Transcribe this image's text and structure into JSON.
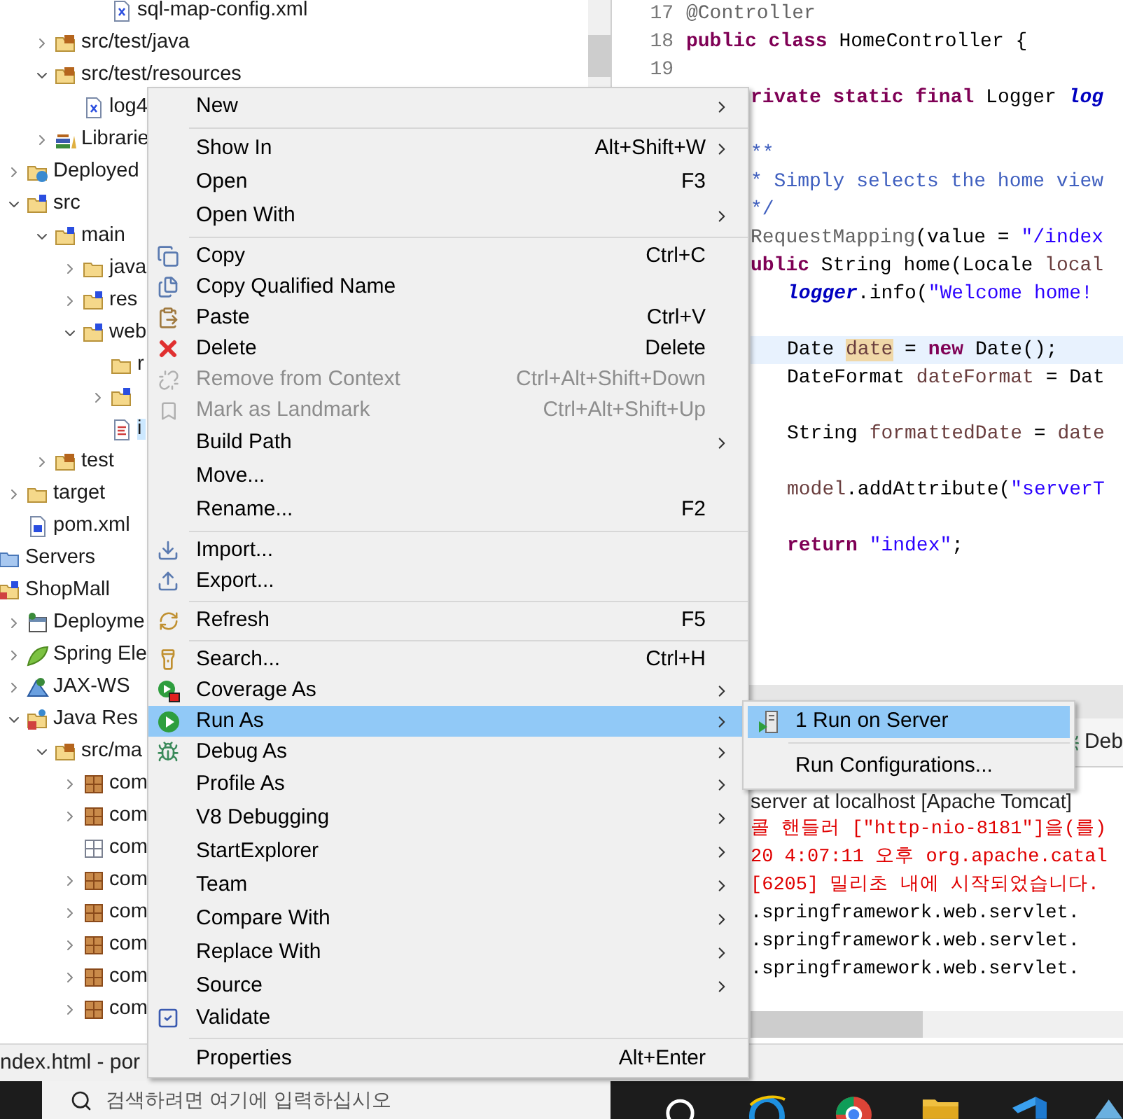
{
  "tree": [
    {
      "children": [
        {
          "children": [
            {
              "children": [
                {
                  "children": [
                    {
                      "label": "sql-map-config.xml",
                      "kind": "xml",
                      "selected": false
                    }
                  ]
                }
              ]
            },
            {
              "label": "src/test/java",
              "kind": "source-folder",
              "expanded": false,
              "selected": false
            },
            {
              "label": "src/test/resources",
              "kind": "source-folder",
              "expanded": true,
              "selected": false,
              "children": [
                {
                  "label": "log4",
                  "kind": "xml",
                  "selected": false
                }
              ]
            },
            {
              "label": "Librarie",
              "kind": "library",
              "expanded": false,
              "selected": false
            }
          ]
        },
        {
          "label": "Deployed",
          "kind": "deployed",
          "expanded": false,
          "selected": false
        },
        {
          "label": "src",
          "kind": "spring-folder",
          "expanded": true,
          "selected": false,
          "children": [
            {
              "label": "main",
              "kind": "spring-folder",
              "expanded": true,
              "selected": false,
              "children": [
                {
                  "label": "java",
                  "kind": "folder",
                  "expanded": false,
                  "selected": false
                },
                {
                  "label": "res",
                  "kind": "spring-folder",
                  "expanded": false,
                  "selected": false
                },
                {
                  "label": "web",
                  "kind": "spring-folder",
                  "expanded": true,
                  "selected": false,
                  "children": [
                    {
                      "label": "r",
                      "kind": "folder",
                      "selected": false
                    },
                    {
                      "kind": "spring-folder",
                      "expanded": false,
                      "selected": false
                    },
                    {
                      "label": "i",
                      "kind": "html",
                      "selected": true
                    }
                  ]
                }
              ]
            },
            {
              "label": "test",
              "kind": "source-folder",
              "expanded": false,
              "selected": false
            }
          ]
        },
        {
          "label": "target",
          "kind": "folder",
          "expanded": false,
          "selected": false
        },
        {
          "label": "pom.xml",
          "kind": "maven",
          "selected": false
        }
      ]
    },
    {
      "label": "Servers",
      "kind": "servers",
      "selected": false
    },
    {
      "label": "ShopMall",
      "kind": "project",
      "selected": false,
      "children": [
        {
          "label": "Deployme",
          "kind": "deploy-descriptor",
          "expanded": false,
          "selected": false
        },
        {
          "label": "Spring Ele",
          "kind": "spring",
          "expanded": false,
          "selected": false
        },
        {
          "label": "JAX-WS",
          "kind": "webservice",
          "expanded": false,
          "selected": false
        },
        {
          "label": "Java Res",
          "kind": "java-resources",
          "expanded": true,
          "selected": false,
          "children": [
            {
              "label": "src/ma",
              "kind": "source-folder",
              "expanded": true,
              "selected": false,
              "children": [
                {
                  "label": "com",
                  "kind": "package",
                  "expanded": false,
                  "selected": false
                },
                {
                  "label": "com",
                  "kind": "package",
                  "expanded": false,
                  "selected": false
                },
                {
                  "label": "com",
                  "kind": "empty-package",
                  "selected": false
                },
                {
                  "label": "com",
                  "kind": "package",
                  "expanded": false,
                  "selected": false
                },
                {
                  "label": "com",
                  "kind": "package",
                  "expanded": false,
                  "selected": false
                },
                {
                  "label": "com",
                  "kind": "package",
                  "expanded": false,
                  "selected": false
                },
                {
                  "label": "com",
                  "kind": "package",
                  "expanded": false,
                  "selected": false
                },
                {
                  "label": "com",
                  "kind": "package",
                  "expanded": false,
                  "selected": false
                }
              ]
            }
          ]
        }
      ]
    }
  ],
  "editor": {
    "lines": [
      {
        "kind": "code",
        "number": "17",
        "tokens": [
          {
            "t": "@Controller",
            "kind": "annotation"
          }
        ]
      },
      {
        "kind": "code",
        "number": "18",
        "tokens": [
          {
            "t": "public class",
            "kind": "keyword"
          },
          {
            "t": " HomeController {",
            "kind": "plain"
          }
        ]
      },
      {
        "kind": "code",
        "number": "19"
      },
      {
        "kind": "code",
        "tokens": [
          {
            "t": "rivate static final",
            "kind": "keyword"
          },
          {
            "t": " Logger ",
            "kind": "plain"
          },
          {
            "t": "log",
            "kind": "field"
          }
        ]
      },
      {
        "kind": "blank"
      },
      {
        "kind": "code",
        "tokens": [
          {
            "t": "**",
            "kind": "comment"
          }
        ]
      },
      {
        "kind": "code",
        "tokens": [
          {
            "t": "* Simply selects the home view",
            "kind": "comment"
          }
        ]
      },
      {
        "kind": "code",
        "tokens": [
          {
            "t": "*/",
            "kind": "comment"
          }
        ]
      },
      {
        "kind": "code",
        "tokens": [
          {
            "t": "RequestMapping",
            "kind": "annotation"
          },
          {
            "t": "(value = ",
            "kind": "plain"
          },
          {
            "t": "\"/index",
            "kind": "string"
          }
        ]
      },
      {
        "kind": "code",
        "tokens": [
          {
            "t": "ublic",
            "kind": "keyword"
          },
          {
            "t": " String home(Locale ",
            "kind": "plain"
          },
          {
            "t": "local",
            "kind": "variable"
          }
        ]
      },
      {
        "kind": "code",
        "indent": true,
        "tokens": [
          {
            "t": "logger",
            "kind": "field"
          },
          {
            "t": ".info(",
            "kind": "plain"
          },
          {
            "t": "\"Welcome home!",
            "kind": "string"
          }
        ]
      },
      {
        "kind": "blank"
      },
      {
        "kind": "code",
        "indent": true,
        "current": true,
        "tokens": [
          {
            "t": "Date ",
            "kind": "plain"
          },
          {
            "t": "date",
            "kind": "occurrence"
          },
          {
            "t": " = ",
            "kind": "plain"
          },
          {
            "t": "new",
            "kind": "keyword"
          },
          {
            "t": " Date();",
            "kind": "plain"
          }
        ]
      },
      {
        "kind": "code",
        "indent": true,
        "tokens": [
          {
            "t": "DateFormat ",
            "kind": "plain"
          },
          {
            "t": "dateFormat",
            "kind": "variable"
          },
          {
            "t": " = Dat",
            "kind": "plain"
          }
        ]
      },
      {
        "kind": "blank"
      },
      {
        "kind": "code",
        "indent": true,
        "tokens": [
          {
            "t": "String ",
            "kind": "plain"
          },
          {
            "t": "formattedDate",
            "kind": "variable"
          },
          {
            "t": " = ",
            "kind": "plain"
          },
          {
            "t": "date",
            "kind": "variable"
          }
        ]
      },
      {
        "kind": "blank"
      },
      {
        "kind": "code",
        "indent": true,
        "tokens": [
          {
            "t": "model",
            "kind": "variable"
          },
          {
            "t": ".addAttribute(",
            "kind": "plain"
          },
          {
            "t": "\"serverT",
            "kind": "string"
          }
        ]
      },
      {
        "kind": "blank"
      },
      {
        "kind": "code",
        "indent": true,
        "tokens": [
          {
            "t": "return",
            "kind": "keyword"
          },
          {
            "t": " \"index\"",
            "kind": "string"
          },
          {
            "t": ";",
            "kind": "plain"
          }
        ]
      }
    ]
  },
  "bottom_panel": {
    "tab": "Deb",
    "console_title": "server at localhost [Apache Tomcat]",
    "lines": [
      {
        "text": "콜 핸들러 [\"http-nio-8181\"]을(를)",
        "kind": "error"
      },
      {
        "text": "20 4:07:11 오후 org.apache.catal",
        "kind": "error"
      },
      {
        "text": "[6205] 밀리초 내에 시작되었습니다.",
        "kind": "error"
      },
      {
        "text": ".springframework.web.servlet.",
        "kind": "plain"
      },
      {
        "text": ".springframework.web.servlet.",
        "kind": "plain"
      },
      {
        "text": ".springframework.web.servlet.",
        "kind": "plain"
      }
    ]
  },
  "status_bar": {
    "text": "ndex.html - por"
  },
  "taskbar": {
    "search_placeholder": "검색하려면 여기에 입력하십시오"
  },
  "menu": {
    "items": [
      {
        "kind": "item",
        "label": "New",
        "submenu": true,
        "disabled": false,
        "selected": false
      },
      {
        "kind": "separator"
      },
      {
        "kind": "item",
        "label": "Show In",
        "shortcut": "Alt+Shift+W",
        "submenu": true,
        "disabled": false,
        "selected": false
      },
      {
        "kind": "item",
        "label": "Open",
        "shortcut": "F3",
        "submenu": false,
        "disabled": false,
        "selected": false
      },
      {
        "kind": "item",
        "label": "Open With",
        "submenu": true,
        "disabled": false,
        "selected": false
      },
      {
        "kind": "separator"
      },
      {
        "kind": "item",
        "label": "Copy",
        "shortcut": "Ctrl+C",
        "submenu": false,
        "disabled": false,
        "selected": false
      },
      {
        "kind": "item",
        "label": "Copy Qualified Name",
        "submenu": false,
        "disabled": false,
        "selected": false
      },
      {
        "kind": "item",
        "label": "Paste",
        "shortcut": "Ctrl+V",
        "submenu": false,
        "disabled": false,
        "selected": false
      },
      {
        "kind": "item",
        "label": "Delete",
        "shortcut": "Delete",
        "submenu": false,
        "disabled": false,
        "selected": false
      },
      {
        "kind": "item",
        "label": "Remove from Context",
        "shortcut": "Ctrl+Alt+Shift+Down",
        "submenu": false,
        "disabled": true,
        "selected": false
      },
      {
        "kind": "item",
        "label": "Mark as Landmark",
        "shortcut": "Ctrl+Alt+Shift+Up",
        "submenu": false,
        "disabled": true,
        "selected": false
      },
      {
        "kind": "item",
        "label": "Build Path",
        "submenu": true,
        "disabled": false,
        "selected": false
      },
      {
        "kind": "item",
        "label": "Move...",
        "submenu": false,
        "disabled": false,
        "selected": false
      },
      {
        "kind": "item",
        "label": "Rename...",
        "shortcut": "F2",
        "submenu": false,
        "disabled": false,
        "selected": false
      },
      {
        "kind": "separator"
      },
      {
        "kind": "item",
        "label": "Import...",
        "submenu": false,
        "disabled": false,
        "selected": false
      },
      {
        "kind": "item",
        "label": "Export...",
        "submenu": false,
        "disabled": false,
        "selected": false
      },
      {
        "kind": "separator"
      },
      {
        "kind": "item",
        "label": "Refresh",
        "shortcut": "F5",
        "submenu": false,
        "disabled": false,
        "selected": false
      },
      {
        "kind": "separator"
      },
      {
        "kind": "item",
        "label": "Search...",
        "shortcut": "Ctrl+H",
        "submenu": false,
        "disabled": false,
        "selected": false
      },
      {
        "kind": "item",
        "label": "Coverage As",
        "submenu": true,
        "disabled": false,
        "selected": false
      },
      {
        "kind": "item",
        "label": "Run As",
        "submenu": true,
        "disabled": false,
        "selected": true
      },
      {
        "kind": "item",
        "label": "Debug As",
        "submenu": true,
        "disabled": false,
        "selected": false
      },
      {
        "kind": "item",
        "label": "Profile As",
        "submenu": true,
        "disabled": false,
        "selected": false
      },
      {
        "kind": "item",
        "label": "V8 Debugging",
        "submenu": true,
        "disabled": false,
        "selected": false
      },
      {
        "kind": "item",
        "label": "StartExplorer",
        "submenu": true,
        "disabled": false,
        "selected": false
      },
      {
        "kind": "item",
        "label": "Team",
        "submenu": true,
        "disabled": false,
        "selected": false
      },
      {
        "kind": "item",
        "label": "Compare With",
        "submenu": true,
        "disabled": false,
        "selected": false
      },
      {
        "kind": "item",
        "label": "Replace With",
        "submenu": true,
        "disabled": false,
        "selected": false
      },
      {
        "kind": "item",
        "label": "Source",
        "submenu": true,
        "disabled": false,
        "selected": false
      },
      {
        "kind": "item",
        "label": "Validate",
        "submenu": false,
        "disabled": false,
        "selected": false
      },
      {
        "kind": "separator"
      },
      {
        "kind": "item",
        "label": "Properties",
        "shortcut": "Alt+Enter",
        "submenu": false,
        "disabled": false,
        "selected": false
      }
    ]
  },
  "submenu": {
    "items": [
      {
        "kind": "item",
        "label": "1 Run on Server",
        "selected": true
      },
      {
        "kind": "separator"
      },
      {
        "kind": "item",
        "label": "Run Configurations...",
        "selected": false
      }
    ]
  }
}
